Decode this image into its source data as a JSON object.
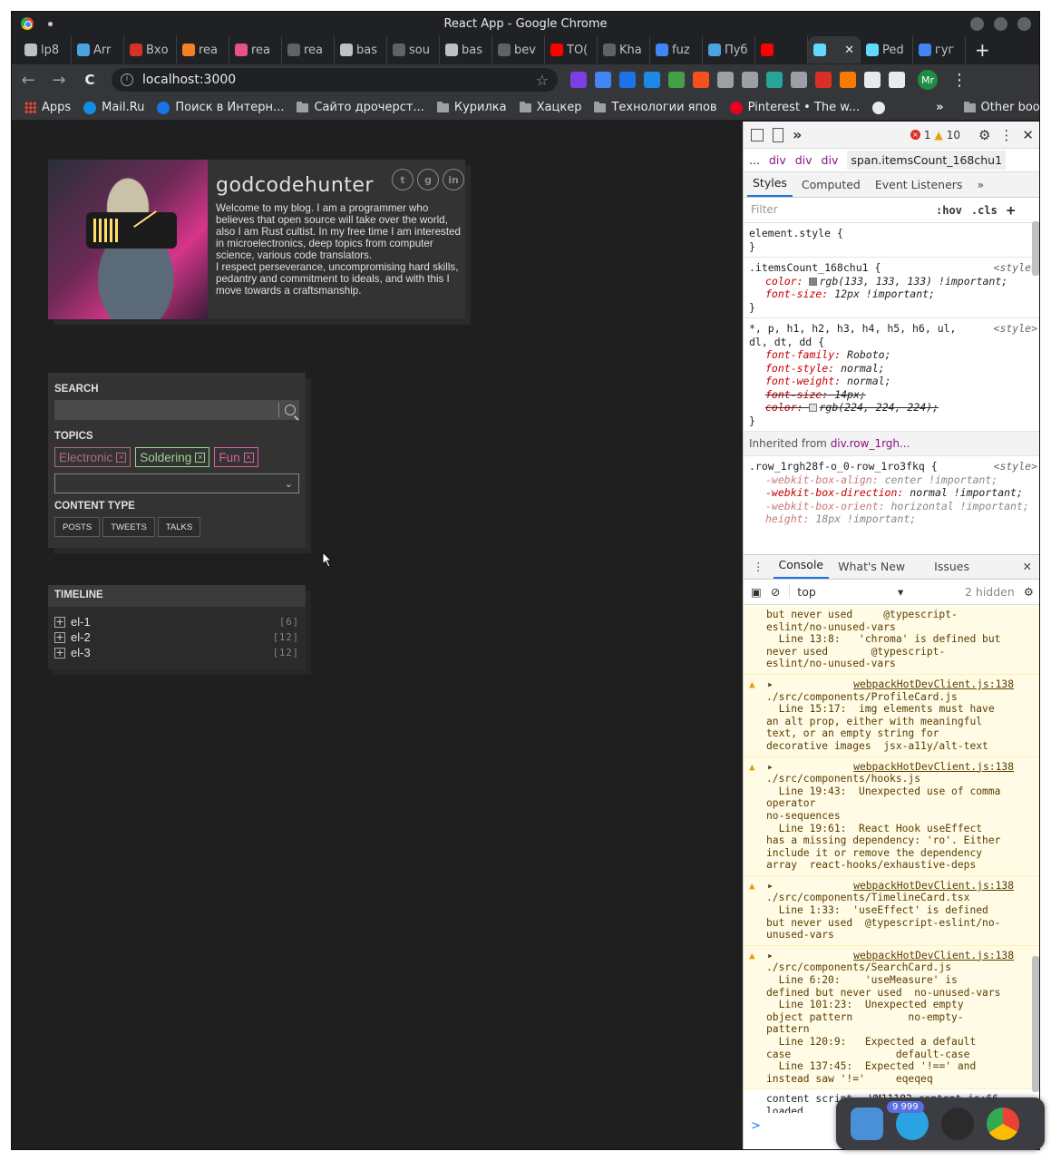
{
  "window": {
    "title": "React App - Google Chrome"
  },
  "tabs": [
    {
      "label": "lp8",
      "color": "#bdc1c6"
    },
    {
      "label": "Arr",
      "color": "#4aa3df"
    },
    {
      "label": "Вхо",
      "color": "#d93025"
    },
    {
      "label": "rea",
      "color": "#f48024"
    },
    {
      "label": "rea",
      "color": "#e8528b"
    },
    {
      "label": "rea",
      "color": "#5f6368"
    },
    {
      "label": "bas",
      "color": "#bdc1c6"
    },
    {
      "label": "sou",
      "color": "#5f6368"
    },
    {
      "label": "bas",
      "color": "#bdc1c6"
    },
    {
      "label": "bev",
      "color": "#5f6368"
    },
    {
      "label": "TO(",
      "color": "#ff0000"
    },
    {
      "label": "Kha",
      "color": "#5f6368"
    },
    {
      "label": "fuz",
      "color": "#4285f4"
    },
    {
      "label": "Пуб",
      "color": "#4aa3df"
    },
    {
      "label": "",
      "color": "#ff0000"
    },
    {
      "label": "",
      "color": "#61dafb",
      "active": true
    },
    {
      "label": "Ped",
      "color": "#61dafb"
    },
    {
      "label": "гуг",
      "color": "#4285f4"
    }
  ],
  "tab_close": "✕",
  "new_tab": "+",
  "toolbar": {
    "back": "←",
    "forward": "→",
    "reload": "C",
    "url": "localhost:3000",
    "bookmark_star": "☆",
    "profile": "Mr",
    "menu": "⋮",
    "ext_colors": [
      "#7b3fe4",
      "#4285f4",
      "#1a73e8",
      "#1e88e5",
      "#43a047",
      "#f4511e",
      "#9aa0a6",
      "#9aa0a6",
      "#26a69a",
      "#9aa0a6",
      "#d93025",
      "#f57c00",
      "#e8eaed",
      "#e8eaed"
    ]
  },
  "bookmarks": [
    {
      "label": "Apps",
      "icon": "apps-grid-icon"
    },
    {
      "label": "Mail.Ru",
      "icon": "mailru-icon"
    },
    {
      "label": "Поиск в Интерн...",
      "icon": "search-engine-icon"
    },
    {
      "label": "Сайто дрочерст...",
      "icon": "folder-icon"
    },
    {
      "label": "Курилка",
      "icon": "folder-icon"
    },
    {
      "label": "Хацкер",
      "icon": "folder-icon"
    },
    {
      "label": "Технологии япов",
      "icon": "folder-icon"
    },
    {
      "label": "Pinterest • The w...",
      "icon": "pinterest-icon"
    },
    {
      "label": "",
      "icon": "globe-icon"
    }
  ],
  "bookmarks_more": "»",
  "other_bookmarks": "Other bookmarks",
  "profile_card": {
    "name": "godcodehunter",
    "bio": "Welcome to my blog. I am a programmer who believes that open source will take over the world, also I am Rust cultist. In my free time I am interested in microelectronics, deep topics from computer science, various code translators.\nI respect perseverance, uncompromising hard skills, pedantry and commitment to ideals, and with this I move towards a craftsmanship."
  },
  "search_card": {
    "search_label": "SEARCH",
    "topics_label": "TOPICS",
    "topics": [
      {
        "label": "Electronic",
        "color": "#b06a7f"
      },
      {
        "label": "Soldering",
        "color": "#9bd28c"
      },
      {
        "label": "Fun",
        "color": "#e05fa9"
      }
    ],
    "chip_x": "☒",
    "select_arrow": "⌄",
    "content_type_label": "CONTENT TYPE",
    "content_types": [
      "POSTS",
      "TWEETS",
      "TALKS"
    ]
  },
  "timeline": {
    "label": "TIMELINE",
    "items": [
      {
        "name": "el-1",
        "count": "[6]"
      },
      {
        "name": "el-2",
        "count": "[12]"
      },
      {
        "name": "el-3",
        "count": "[12]"
      }
    ]
  },
  "devtools": {
    "more_tabs": "»",
    "errors": "1",
    "warnings": "10",
    "crumbs": [
      "...",
      "div",
      "div",
      "div",
      "span.itemsCount_168chu1"
    ],
    "tabs": [
      "Styles",
      "Computed",
      "Event Listeners",
      "»"
    ],
    "filter_placeholder": "Filter",
    "hov": ":hov",
    "cls": ".cls",
    "add": "+",
    "rules": {
      "element_style": "element.style {",
      "close": "}",
      "r1_selector": ".itemsCount_168chu1 {",
      "r1_src": "<style>",
      "r1_p1": "color:",
      "r1_v1": "rgb(133, 133, 133) !important;",
      "r1_p2": "font-size:",
      "r1_v2": "12px !important;",
      "r2_selector": "*, p, h1, h2, h3, h4, h5, h6, ul, dl, dt, dd {",
      "r2_src": "<style>",
      "r2_p1": "font-family:",
      "r2_v1": "Roboto;",
      "r2_p2": "font-style:",
      "r2_v2": "normal;",
      "r2_p3": "font-weight:",
      "r2_v3": "normal;",
      "r2_p4": "font-size:",
      "r2_v4": "14px;",
      "r2_p5": "color:",
      "r2_v5": "rgb(224, 224, 224);",
      "inherited_label": "Inherited from",
      "inherited_from": "div.row_1rgh...",
      "r3_selector": ".row_1rgh28f-o_0-row_1ro3fkq {",
      "r3_src": "<style>",
      "r3_p1": "-webkit-box-align:",
      "r3_v1": "center !important;",
      "r3_p2": "-webkit-box-direction:",
      "r3_v2": "normal !important;",
      "r3_p3": "-webkit-box-orient:",
      "r3_v3": "horizontal !important;",
      "r3_p4": "height:",
      "r3_v4": "18px !important;"
    },
    "drawer_tabs": [
      "Console",
      "What's New",
      "Issues"
    ],
    "context": "top",
    "hidden": "2 hidden",
    "messages": [
      {
        "link": "",
        "text": "but never used     @typescript-\neslint/no-unused-vars\n  Line 13:8:   'chroma' is defined but\nnever used       @typescript-\neslint/no-unused-vars"
      },
      {
        "link": "webpackHotDevClient.js:138",
        "text": "./src/components/ProfileCard.js\n  Line 15:17:  img elements must have\nan alt prop, either with meaningful\ntext, or an empty string for\ndecorative images  jsx-a11y/alt-text"
      },
      {
        "link": "webpackHotDevClient.js:138",
        "text": "./src/components/hooks.js\n  Line 19:43:  Unexpected use of comma\noperator\nno-sequences\n  Line 19:61:  React Hook useEffect\nhas a missing dependency: 'ro'. Either\ninclude it or remove the dependency\narray  react-hooks/exhaustive-deps"
      },
      {
        "link": "webpackHotDevClient.js:138",
        "text": "./src/components/TimelineCard.tsx\n  Line 1:33:  'useEffect' is defined\nbut never used  @typescript-eslint/no-\nunused-vars"
      },
      {
        "link": "webpackHotDevClient.js:138",
        "text": "./src/components/SearchCard.js\n  Line 6:20:    'useMeasure' is\ndefined but never used  no-unused-vars\n  Line 101:23:  Unexpected empty\nobject pattern         no-empty-\npattern\n  Line 120:9:   Expected a default\ncase                 default-case\n  Line 137:45:  Expected '!==' and\ninstead saw '!='     eqeqeq"
      }
    ],
    "info_text": "content script",
    "info_link": "VM11182 content.js:66",
    "info_text2": "loaded",
    "prompt": ">"
  },
  "dock": {
    "telegram_badge": "9 999"
  }
}
